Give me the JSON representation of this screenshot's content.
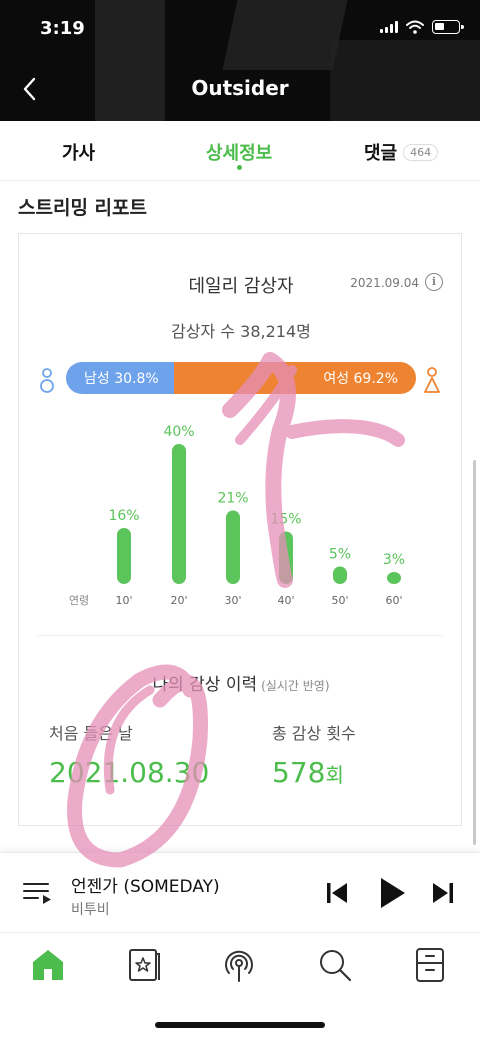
{
  "status_bar": {
    "time": "3:19"
  },
  "nav": {
    "title": "Outsider"
  },
  "tabs": {
    "lyrics": "가사",
    "details": "상세정보",
    "comments": "댓글",
    "comments_count": "464"
  },
  "section_title": "스트리밍 리포트",
  "daily": {
    "title": "데일리 감상자",
    "date": "2021.09.04",
    "listeners": "감상자 수 38,214명"
  },
  "gender": {
    "male_label": "남성 30.8%",
    "female_label": "여성 69.2%",
    "male_pct": 30.8,
    "female_pct": 69.2,
    "male_color": "#6ea3ec",
    "female_color": "#ee8331"
  },
  "chart_data": {
    "type": "bar",
    "xlabel": "연령",
    "categories": [
      "10'",
      "20'",
      "30'",
      "40'",
      "50'",
      "60'"
    ],
    "values": [
      16,
      40,
      21,
      15,
      5,
      3
    ],
    "value_labels": [
      "16%",
      "40%",
      "21%",
      "15%",
      "5%",
      "3%"
    ],
    "color": "#5bc45b",
    "label_color": "#5bc45b"
  },
  "history": {
    "title": "나의 감상 이력",
    "subtitle": "(실시간 반영)",
    "first_listen_label": "처음 들은 날",
    "first_listen_value": "2021.08.30",
    "total_plays_label": "총 감상 횟수",
    "total_plays_value": "578",
    "total_plays_unit": "회"
  },
  "player": {
    "track_title": "언젠가 (SOMEDAY)",
    "artist": "비투비"
  },
  "icons": {
    "back": "chevron-left-icon",
    "info": "info-icon",
    "male": "male-person-icon",
    "female": "female-person-icon",
    "playlist": "playlist-icon",
    "prev": "skip-previous-icon",
    "play": "play-icon",
    "next": "skip-next-icon",
    "home": "home-icon",
    "library": "library-star-icon",
    "podcast": "podcast-icon",
    "search": "search-icon",
    "storage": "drawer-icon"
  },
  "colors": {
    "accent": "#4cbd4c",
    "annotation": "#e58fb8"
  }
}
